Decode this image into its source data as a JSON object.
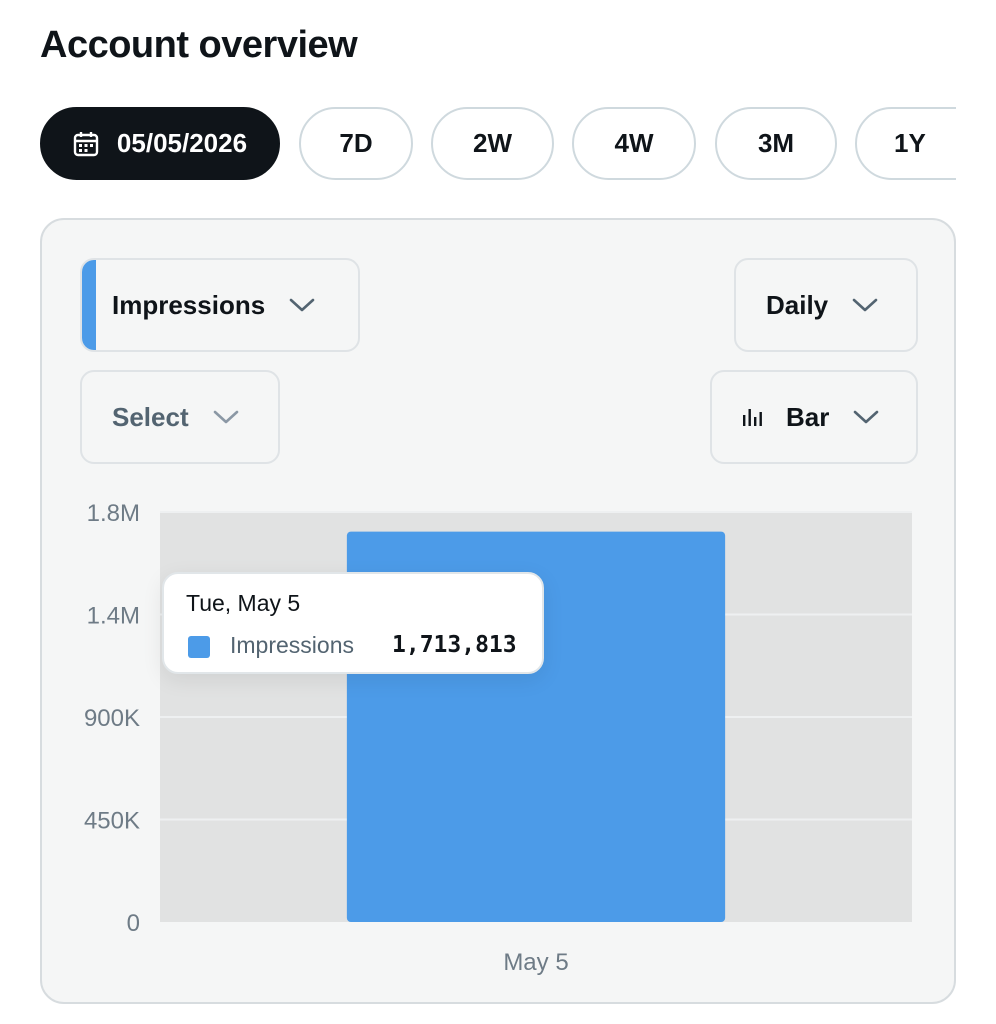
{
  "header": {
    "title": "Account overview"
  },
  "range": {
    "date_label": "05/05/2026",
    "options": [
      "7D",
      "2W",
      "4W",
      "3M",
      "1Y"
    ]
  },
  "controls": {
    "metric": "Impressions",
    "period": "Daily",
    "compare": "Select",
    "chart_type": "Bar"
  },
  "tooltip": {
    "date": "Tue, May 5",
    "label": "Impressions",
    "value": "1,713,813"
  },
  "colors": {
    "accent": "#4c9be8",
    "active_pill": "#0f1419",
    "plot_bg": "#e1e2e2"
  },
  "chart_data": {
    "type": "bar",
    "categories": [
      "May 5"
    ],
    "series": [
      {
        "name": "Impressions",
        "values": [
          1713813
        ]
      }
    ],
    "yticks": [
      {
        "value": 0,
        "label": "0"
      },
      {
        "value": 450000,
        "label": "450K"
      },
      {
        "value": 900000,
        "label": "900K"
      },
      {
        "value": 1350000,
        "label": "1.4M"
      },
      {
        "value": 1800000,
        "label": "1.8M"
      }
    ],
    "ylim": [
      0,
      1800000
    ],
    "grid": true,
    "legend": "none"
  }
}
